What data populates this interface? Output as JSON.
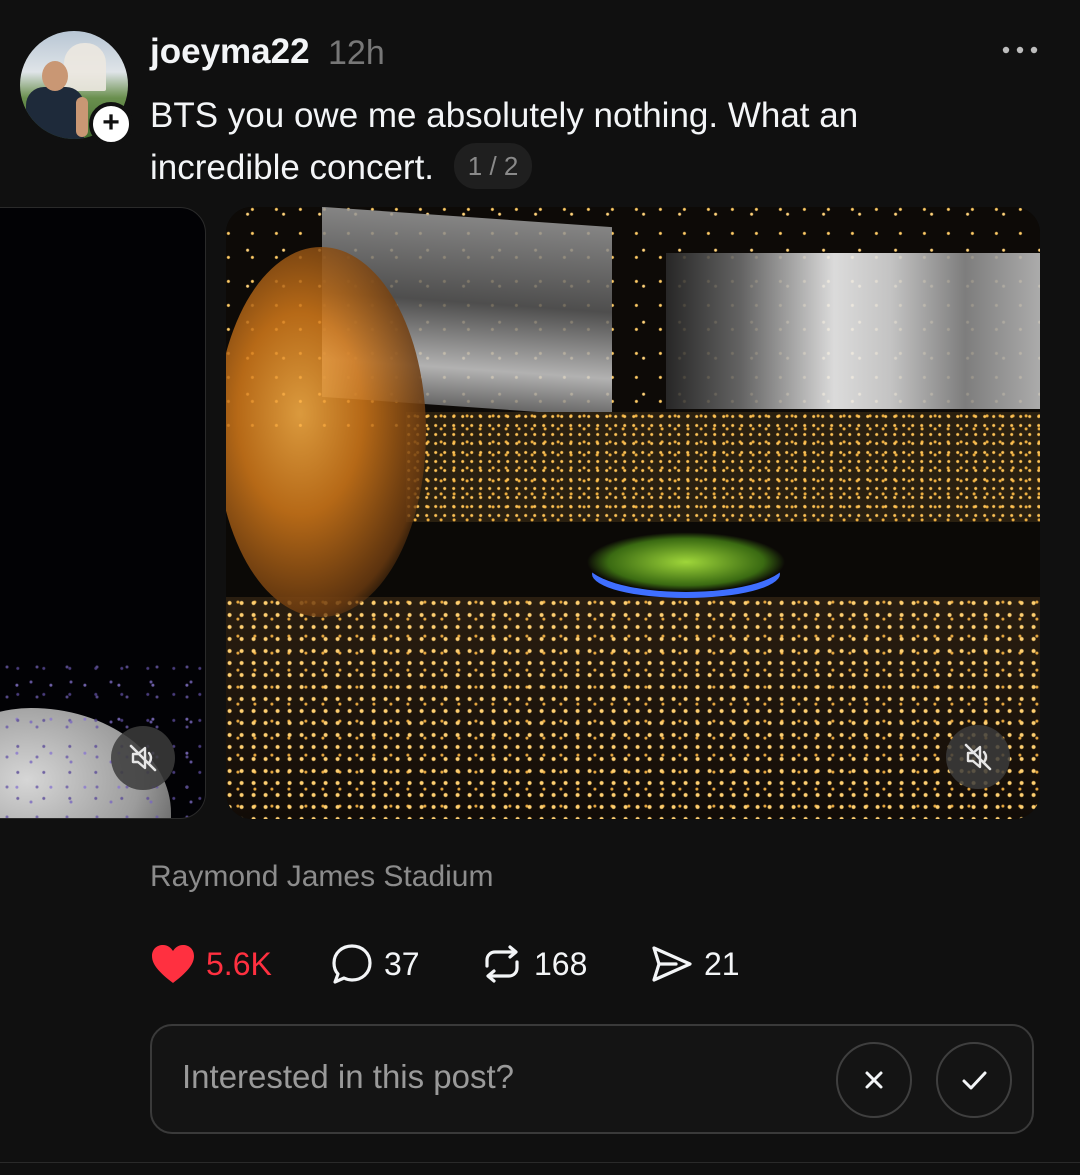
{
  "post": {
    "username": "joeyma22",
    "timestamp": "12h",
    "text": "BTS you owe me absolutely nothing. What an incredible concert.",
    "page_indicator": "1 / 2",
    "location": "Raymond James Stadium"
  },
  "actions": {
    "likes": "5.6K",
    "comments": "37",
    "reposts": "168",
    "shares": "21"
  },
  "interest": {
    "prompt": "Interested in this post?"
  },
  "icons": {
    "more": "more-horizontal-icon",
    "follow": "plus-icon",
    "mute": "volume-muted-icon",
    "like": "heart-icon",
    "comment": "comment-bubble-icon",
    "repost": "repost-arrows-icon",
    "share": "send-icon",
    "dismiss": "close-icon",
    "accept": "checkmark-icon"
  },
  "colors": {
    "like_active": "#ff3040",
    "background": "#101010",
    "secondary_text": "#777777"
  }
}
